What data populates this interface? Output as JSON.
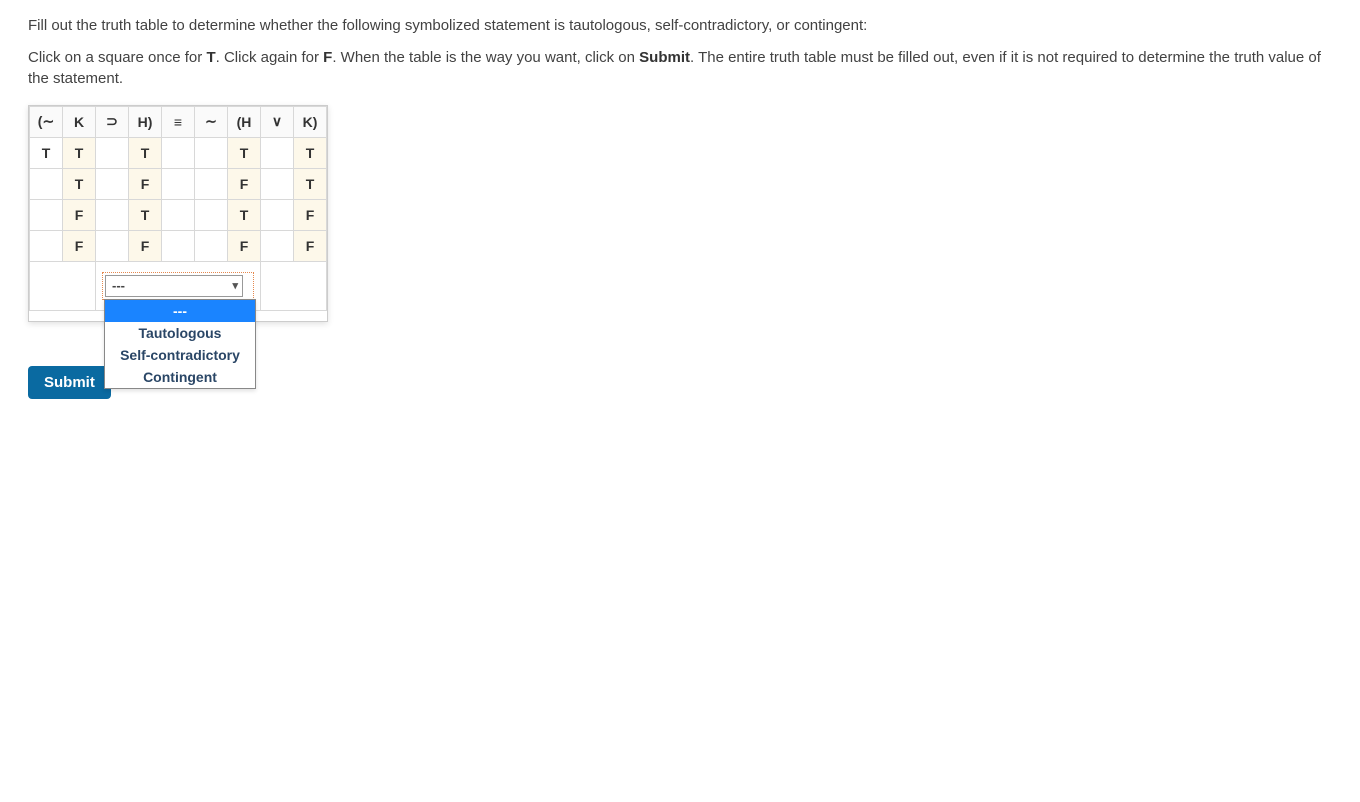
{
  "instructions": {
    "p1": "Fill out the truth table to determine whether the following symbolized statement is tautologous, self-contradictory, or contingent:",
    "p2_a": "Click on a square once for ",
    "p2_T": "T",
    "p2_b": ". Click again for ",
    "p2_F": "F",
    "p2_c": ". When the table is the way you want, click on ",
    "p2_submit": "Submit",
    "p2_d": ". The entire truth table must be filled out, even if it is not required to determine the truth value of the statement."
  },
  "headers": [
    "(∼",
    "K",
    "⊃",
    "H)",
    "≡",
    "∼",
    "(H",
    "∨",
    "K)"
  ],
  "rows": [
    {
      "cells": [
        {
          "val": "T",
          "type": "entered"
        },
        {
          "val": "T",
          "type": "given"
        },
        {
          "val": "",
          "type": "clickable"
        },
        {
          "val": "T",
          "type": "given"
        },
        {
          "val": "",
          "type": "clickable"
        },
        {
          "val": "",
          "type": "clickable"
        },
        {
          "val": "T",
          "type": "given"
        },
        {
          "val": "",
          "type": "clickable"
        },
        {
          "val": "T",
          "type": "given"
        }
      ]
    },
    {
      "cells": [
        {
          "val": "",
          "type": "clickable"
        },
        {
          "val": "T",
          "type": "given"
        },
        {
          "val": "",
          "type": "clickable"
        },
        {
          "val": "F",
          "type": "given"
        },
        {
          "val": "",
          "type": "clickable"
        },
        {
          "val": "",
          "type": "clickable"
        },
        {
          "val": "F",
          "type": "given"
        },
        {
          "val": "",
          "type": "clickable"
        },
        {
          "val": "T",
          "type": "given"
        }
      ]
    },
    {
      "cells": [
        {
          "val": "",
          "type": "clickable"
        },
        {
          "val": "F",
          "type": "given"
        },
        {
          "val": "",
          "type": "clickable"
        },
        {
          "val": "T",
          "type": "given"
        },
        {
          "val": "",
          "type": "clickable"
        },
        {
          "val": "",
          "type": "clickable"
        },
        {
          "val": "T",
          "type": "given"
        },
        {
          "val": "",
          "type": "clickable"
        },
        {
          "val": "F",
          "type": "given"
        }
      ]
    },
    {
      "cells": [
        {
          "val": "",
          "type": "clickable"
        },
        {
          "val": "F",
          "type": "given"
        },
        {
          "val": "",
          "type": "clickable"
        },
        {
          "val": "F",
          "type": "given"
        },
        {
          "val": "",
          "type": "clickable"
        },
        {
          "val": "",
          "type": "clickable"
        },
        {
          "val": "F",
          "type": "given"
        },
        {
          "val": "",
          "type": "clickable"
        },
        {
          "val": "F",
          "type": "given"
        }
      ]
    }
  ],
  "dropdown": {
    "selected": "---",
    "options": [
      "---",
      "Tautologous",
      "Self-contradictory",
      "Contingent"
    ],
    "highlighted_index": 0
  },
  "submit_label": "Submit"
}
